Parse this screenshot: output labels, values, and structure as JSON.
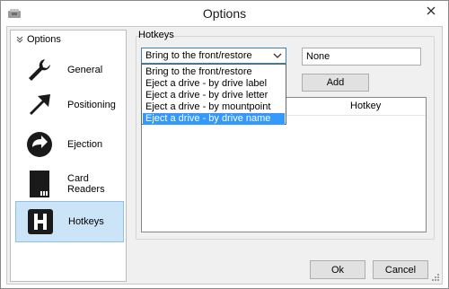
{
  "window": {
    "title": "Options"
  },
  "sidebar": {
    "header": "Options",
    "items": [
      {
        "label": "General",
        "icon": "wrench-icon"
      },
      {
        "label": "Positioning",
        "icon": "arrow-icon"
      },
      {
        "label": "Ejection",
        "icon": "eject-arrow-icon"
      },
      {
        "label": "Card Readers",
        "icon": "sd-card-icon"
      },
      {
        "label": "Hotkeys",
        "icon": "h-letter-icon",
        "selected": true
      }
    ]
  },
  "hotkeys": {
    "group_title": "Hotkeys",
    "selected_action": "Bring to the front/restore",
    "dropdown_options": [
      "Bring to the front/restore",
      "Eject a drive - by drive label",
      "Eject a drive - by drive letter",
      "Eject a drive - by mountpoint",
      "Eject a drive - by drive name"
    ],
    "highlighted_option": "Eject a drive - by drive name",
    "hotkey_value": "None",
    "add_label": "Add",
    "list_columns": [
      "Hotkey"
    ]
  },
  "footer": {
    "ok_label": "Ok",
    "cancel_label": "Cancel"
  },
  "colors": {
    "selection_bg": "#cce4f7",
    "highlight": "#3399ff",
    "focus_border": "#3c7fb1"
  }
}
